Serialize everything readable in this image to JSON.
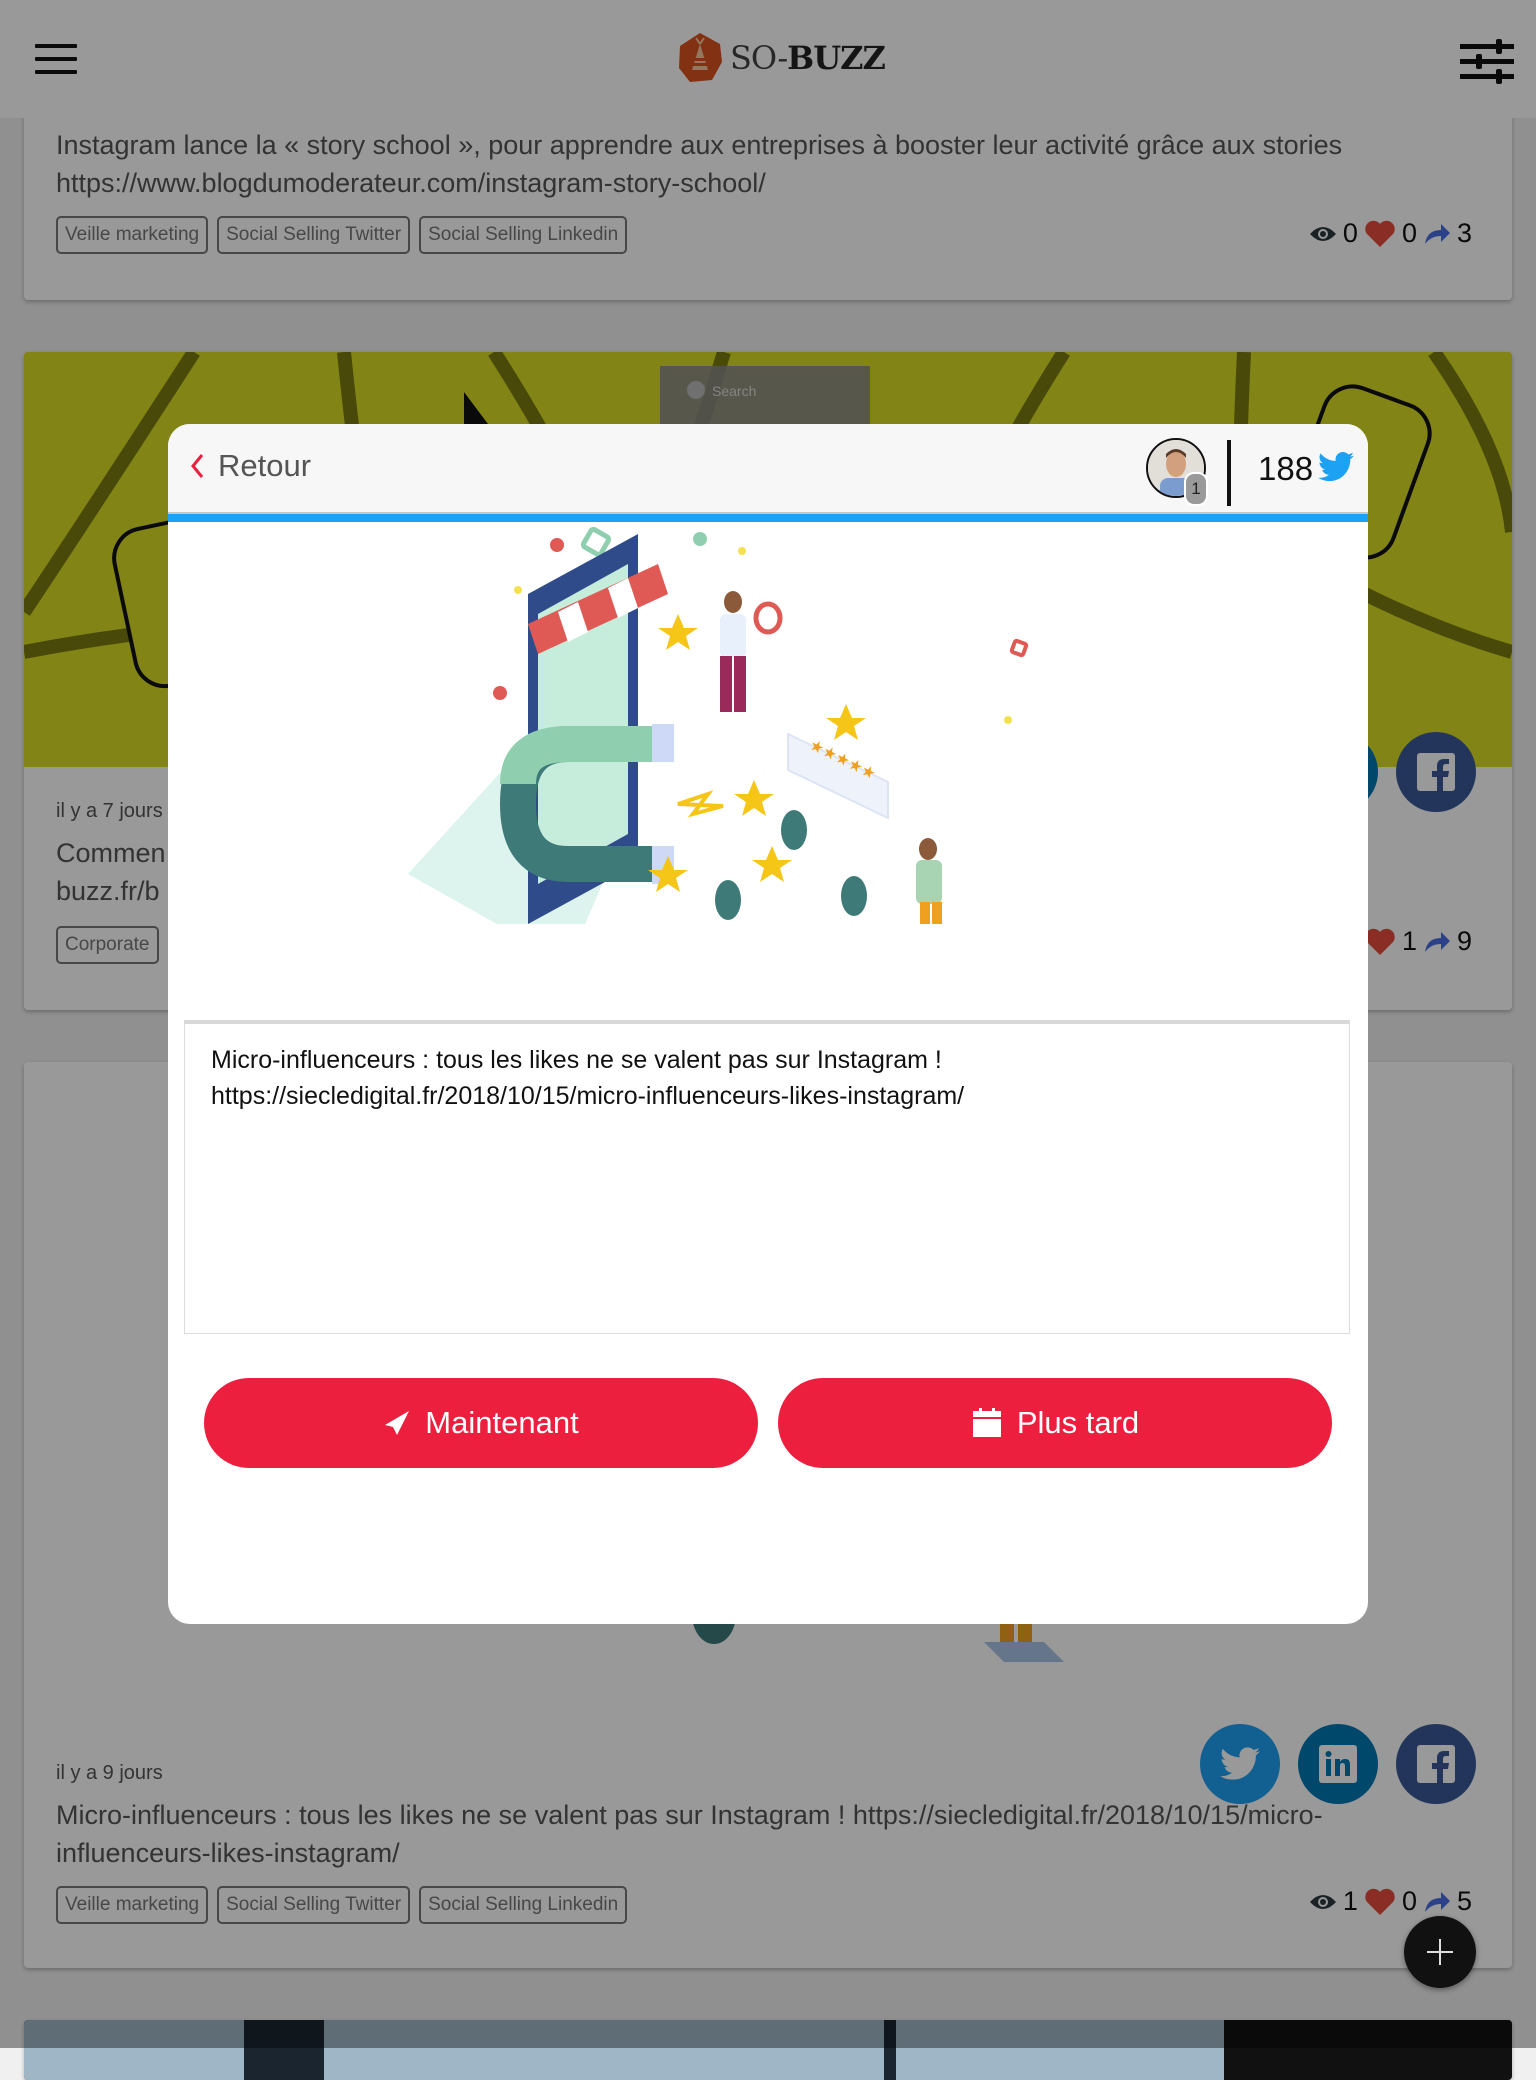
{
  "header": {
    "logo_text_so": "SO-",
    "logo_text_buzz": "BUZZ",
    "menu_icon": "hamburger-icon",
    "filter_icon": "sliders-icon"
  },
  "feed": {
    "cards": [
      {
        "title": "Instagram lance la « story school », pour apprendre aux entreprises à booster leur activité grâce aux stories https://www.blogdumoderateur.com/instagram-story-school/",
        "tags": [
          "Veille marketing",
          "Social Selling Twitter",
          "Social Selling Linkedin"
        ],
        "stats": {
          "views": "0",
          "likes": "0",
          "shares": "3"
        }
      },
      {
        "date": "il y a 7 jours",
        "title": "Commen… buzz.fr/b…",
        "title_line1": "Commen",
        "title_line2": "buzz.fr/b",
        "tags": [
          "Corporate"
        ],
        "stats": {
          "likes": "1",
          "shares": "9"
        },
        "banner_search_text": "Search"
      },
      {
        "date": "il y a 9 jours",
        "title": "Micro-influenceurs : tous les likes ne se valent pas sur Instagram ! https://siecledigital.fr/2018/10/15/micro-influenceurs-likes-instagram/",
        "tags": [
          "Veille marketing",
          "Social Selling Twitter",
          "Social Selling Linkedin"
        ],
        "stats": {
          "views": "1",
          "likes": "0",
          "shares": "5"
        },
        "share_buttons": [
          {
            "network": "twitter",
            "color": "#1da1f2"
          },
          {
            "network": "linkedin",
            "color": "#0077b5"
          },
          {
            "network": "facebook",
            "color": "#3b5998"
          }
        ]
      }
    ]
  },
  "modal": {
    "back_label": "Retour",
    "account_badge": "1",
    "account_count": "188",
    "network_icon": "twitter-icon",
    "message": "Micro-influenceurs : tous les likes ne se valent pas sur Instagram !\nhttps://siecledigital.fr/2018/10/15/micro-influenceurs-likes-instagram/",
    "buttons": {
      "now_label": "Maintenant",
      "later_label": "Plus tard"
    }
  },
  "colors": {
    "accent_red": "#ec1f3e",
    "twitter_blue": "#1da1f2",
    "linkedin_blue": "#0077b5",
    "facebook_blue": "#3b5998",
    "banner_yellow": "#d9dd26",
    "heart_red": "#e74c3c",
    "share_blue": "#4a6fe3"
  }
}
